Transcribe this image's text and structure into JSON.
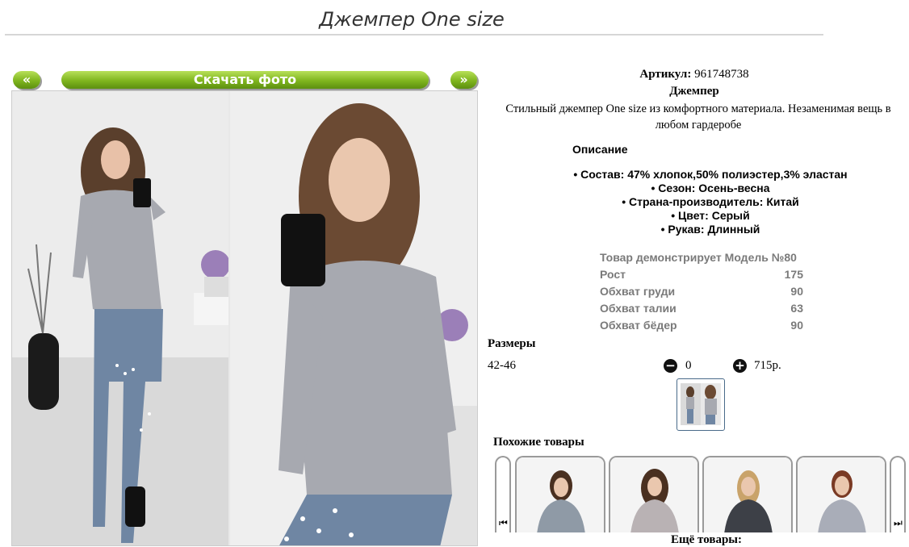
{
  "page": {
    "title": "Джемпер One size"
  },
  "photo_nav": {
    "prev_label": "«",
    "download_label": "Скачать фото",
    "next_label": "»"
  },
  "product": {
    "sku_label": "Артикул:",
    "sku_value": "961748738",
    "name": "Джемпер",
    "description": "Стильный джемпер One size из комфортного материала. Незаменимая вещь в любом гардеробе"
  },
  "details": {
    "heading": "Описание",
    "features": [
      "• Состав: 47% хлопок,50% полиэстер,3% эластан",
      "• Сезон: Осень-весна",
      "• Страна-производитель: Китай",
      "• Цвет: Серый",
      "• Рукав: Длинный"
    ]
  },
  "model": {
    "rows": [
      {
        "label": "Товар демонстрирует Модель №80",
        "value": ""
      },
      {
        "label": "Рост",
        "value": "175"
      },
      {
        "label": "Обхват груди",
        "value": "90"
      },
      {
        "label": "Обхват талии",
        "value": "63"
      },
      {
        "label": "Обхват бёдер",
        "value": "90"
      }
    ]
  },
  "sizes": {
    "heading": "Размеры",
    "rows": [
      {
        "size": "42-46",
        "quantity": "0",
        "price": "715р.",
        "minus_icon": "minus-circle-icon",
        "plus_icon": "plus-circle-icon"
      }
    ]
  },
  "similar": {
    "heading": "Похожие товары",
    "prev_icon": "skip-back-icon",
    "next_icon": "skip-forward-icon",
    "item_colors": [
      "#8f9aa6",
      "#b9b2b4",
      "#3d4047",
      "#a9adb8"
    ]
  },
  "more_goods_label": "Ещё товары:",
  "colors": {
    "accent_green": "#7fb51e",
    "sweater_gray": "#a7a9b0",
    "jeans_blue": "#6f86a3"
  }
}
